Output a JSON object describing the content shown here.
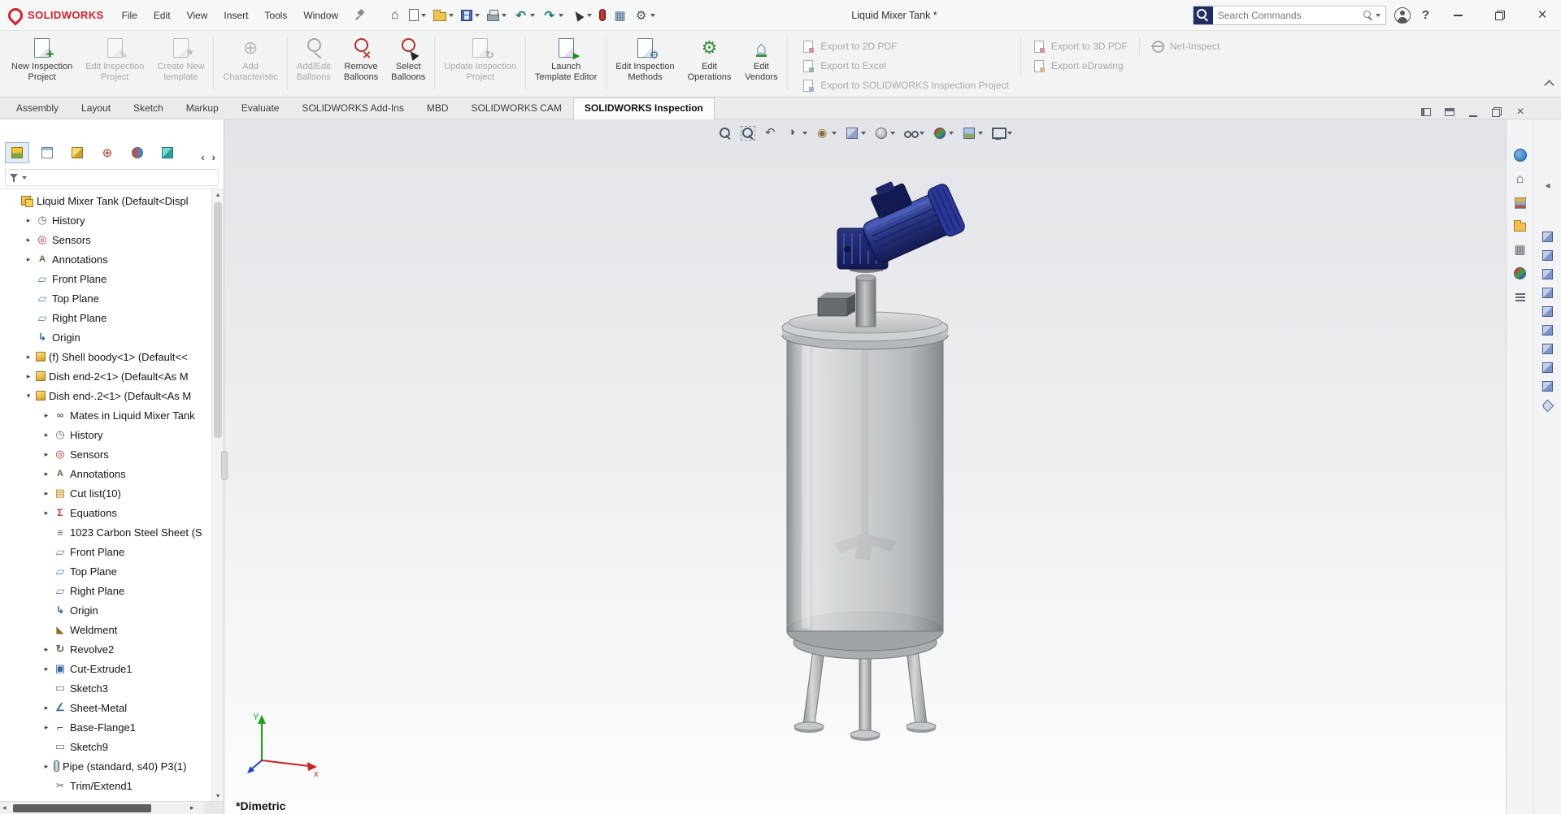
{
  "window": {
    "title": "Liquid Mixer Tank *",
    "brand": "SOLIDWORKS",
    "search_placeholder": "Search Commands"
  },
  "colors": {
    "brand_red": "#d2232a",
    "motor_blue": "#27338f",
    "accent_blue": "#2a6db5",
    "disabled_gray": "#a9a9a9"
  },
  "menubar": {
    "items": [
      {
        "label": "File"
      },
      {
        "label": "Edit"
      },
      {
        "label": "View"
      },
      {
        "label": "Insert"
      },
      {
        "label": "Tools"
      },
      {
        "label": "Window"
      }
    ]
  },
  "quick_toolbar": {
    "items": [
      {
        "name": "home-button",
        "icon": "home-icon",
        "dd": false
      },
      {
        "name": "new-document-button",
        "icon": "new-document-icon",
        "dd": true
      },
      {
        "name": "open-button",
        "icon": "open-icon",
        "dd": true
      },
      {
        "name": "save-button",
        "icon": "save-icon",
        "dd": true
      },
      {
        "name": "print-button",
        "icon": "print-icon",
        "dd": true
      },
      {
        "name": "undo-button",
        "icon": "undo-icon",
        "dd": true
      },
      {
        "name": "redo-button",
        "icon": "redo-icon",
        "dd": true
      },
      {
        "name": "select-button",
        "icon": "select-icon",
        "dd": true
      },
      {
        "name": "xpress-indicator",
        "icon": "xpress-icon",
        "dd": false
      },
      {
        "name": "sheet-button",
        "icon": "sheet-icon",
        "dd": false
      },
      {
        "name": "options-button",
        "icon": "options-icon",
        "dd": true
      }
    ]
  },
  "ribbon": {
    "items": [
      {
        "type": "button",
        "name": "new-inspection-project-button",
        "icon": "new-inspection-project-icon",
        "label": "New Inspection\nProject",
        "state": "enabled",
        "interactable": "true"
      },
      {
        "type": "button",
        "name": "edit-inspection-project-button",
        "icon": "edit-inspection-project-icon",
        "label": "Edit Inspection\nProject",
        "state": "disabled",
        "interactable": "true"
      },
      {
        "type": "button",
        "name": "create-new-template-button",
        "icon": "create-new-template-icon",
        "label": "Create New\ntemplate",
        "state": "disabled",
        "interactable": "true"
      },
      {
        "type": "sep",
        "name": "ribbon-separator",
        "interactable": "false"
      },
      {
        "type": "button",
        "name": "add-characteristic-button",
        "icon": "add-characteristic-icon",
        "label": "Add\nCharacteristic",
        "state": "disabled",
        "interactable": "true"
      },
      {
        "type": "sep",
        "name": "ribbon-separator",
        "interactable": "false"
      },
      {
        "type": "button",
        "name": "add-edit-balloons-button",
        "icon": "add-edit-balloons-icon",
        "label": "Add/Edit\nBalloons",
        "state": "disabled",
        "interactable": "true"
      },
      {
        "type": "button",
        "name": "remove-balloons-button",
        "icon": "remove-balloons-icon",
        "label": "Remove\nBalloons",
        "state": "enabled",
        "interactable": "true"
      },
      {
        "type": "button",
        "name": "select-balloons-button",
        "icon": "select-balloons-icon",
        "label": "Select\nBalloons",
        "state": "enabled",
        "interactable": "true"
      },
      {
        "type": "sep",
        "name": "ribbon-separator",
        "interactable": "false"
      },
      {
        "type": "button",
        "name": "update-inspection-project-button",
        "icon": "update-inspection-project-icon",
        "label": "Update Inspection\nProject",
        "state": "disabled",
        "interactable": "true"
      },
      {
        "type": "sep",
        "name": "ribbon-separator",
        "interactable": "false"
      },
      {
        "type": "button",
        "name": "launch-template-editor-button",
        "icon": "launch-template-editor-icon",
        "label": "Launch\nTemplate Editor",
        "state": "enabled",
        "interactable": "true"
      },
      {
        "type": "sep",
        "name": "ribbon-separator",
        "interactable": "false"
      },
      {
        "type": "button",
        "name": "edit-inspection-methods-button",
        "icon": "edit-inspection-methods-icon",
        "label": "Edit Inspection\nMethods",
        "state": "enabled",
        "interactable": "true"
      },
      {
        "type": "button",
        "name": "edit-operations-button",
        "icon": "edit-operations-icon",
        "label": "Edit\nOperations",
        "state": "enabled",
        "interactable": "true"
      },
      {
        "type": "button",
        "name": "edit-vendors-button",
        "icon": "edit-vendors-icon",
        "label": "Edit\nVendors",
        "state": "enabled",
        "interactable": "true"
      },
      {
        "type": "sep",
        "name": "ribbon-separator",
        "interactable": "false"
      }
    ],
    "export_col1": [
      {
        "name": "export-2d-pdf-button",
        "icon": "export-2d-pdf-icon",
        "label": "Export to 2D PDF"
      },
      {
        "name": "export-excel-button",
        "icon": "export-excel-icon",
        "label": "Export to Excel"
      },
      {
        "name": "export-sw-inspection-button",
        "icon": "export-sw-inspection-icon",
        "label": "Export to SOLIDWORKS Inspection Project"
      }
    ],
    "export_col2": [
      {
        "name": "export-3d-pdf-button",
        "icon": "export-3d-pdf-icon",
        "label": "Export to 3D PDF"
      },
      {
        "name": "export-edrawing-button",
        "icon": "export-edrawing-icon",
        "label": "Export eDrawing"
      }
    ],
    "export_col3": [
      {
        "name": "net-inspect-button",
        "icon": "net-inspect-icon",
        "label": "Net-Inspect"
      }
    ]
  },
  "command_tabs": {
    "items": [
      {
        "label": "Assembly"
      },
      {
        "label": "Layout"
      },
      {
        "label": "Sketch"
      },
      {
        "label": "Markup"
      },
      {
        "label": "Evaluate"
      },
      {
        "label": "SOLIDWORKS Add-Ins"
      },
      {
        "label": "MBD"
      },
      {
        "label": "SOLIDWORKS CAM"
      },
      {
        "label": "SOLIDWORKS Inspection",
        "state": "active"
      }
    ],
    "controls": [
      {
        "name": "dock-pane-button",
        "icon": "dock-pane-icon"
      },
      {
        "name": "float-pane-button",
        "icon": "float-pane-icon"
      },
      {
        "name": "document-minimize-button",
        "icon": "minimize-icon"
      },
      {
        "name": "document-restore-button",
        "icon": "restore-icon"
      },
      {
        "name": "document-close-button",
        "icon": "close-icon"
      }
    ]
  },
  "panel": {
    "tabs": [
      {
        "name": "featuremanager-tab",
        "icon": "featuremanager-icon",
        "state": "active"
      },
      {
        "name": "propertymanager-tab",
        "icon": "propertymanager-icon"
      },
      {
        "name": "configurationmanager-tab",
        "icon": "configurationmanager-icon"
      },
      {
        "name": "dimxpertmanager-tab",
        "icon": "dimxpertmanager-icon"
      },
      {
        "name": "displaymanager-tab",
        "icon": "displaymanager-icon"
      },
      {
        "name": "inspection-manager-tab",
        "icon": "inspection-manager-icon"
      }
    ]
  },
  "feature_tree": {
    "items": [
      {
        "level": 0,
        "arrow": "none",
        "icon": "assembly-icon",
        "label": "Liquid Mixer Tank  (Default<Displ"
      },
      {
        "level": 1,
        "arrow": "right",
        "icon": "history-icon",
        "label": "History"
      },
      {
        "level": 1,
        "arrow": "right",
        "icon": "sensors-icon",
        "label": "Sensors"
      },
      {
        "level": 1,
        "arrow": "right",
        "icon": "annotations-icon",
        "label": "Annotations"
      },
      {
        "level": 1,
        "arrow": "none",
        "icon": "plane-icon",
        "label": "Front Plane"
      },
      {
        "level": 1,
        "arrow": "none",
        "icon": "plane-icon",
        "label": "Top Plane"
      },
      {
        "level": 1,
        "arrow": "none",
        "icon": "plane-icon",
        "label": "Right Plane"
      },
      {
        "level": 1,
        "arrow": "none",
        "icon": "origin-icon",
        "label": "Origin"
      },
      {
        "level": 1,
        "arrow": "right",
        "icon": "part-icon",
        "label": "(f) Shell boody<1>  (Default<<"
      },
      {
        "level": 1,
        "arrow": "right",
        "icon": "part-icon",
        "label": "Dish end-2<1>  (Default<As M"
      },
      {
        "level": 1,
        "arrow": "down",
        "icon": "part-icon",
        "label": "Dish end-.2<1>  (Default<As M"
      },
      {
        "level": 2,
        "arrow": "right",
        "icon": "mates-icon",
        "label": "Mates in Liquid Mixer Tank"
      },
      {
        "level": 2,
        "arrow": "right",
        "icon": "history-icon",
        "label": "History"
      },
      {
        "level": 2,
        "arrow": "right",
        "icon": "sensors-icon",
        "label": "Sensors"
      },
      {
        "level": 2,
        "arrow": "right",
        "icon": "annotations-icon",
        "label": "Annotations"
      },
      {
        "level": 2,
        "arrow": "right",
        "icon": "cutlist-icon",
        "label": "Cut list(10)"
      },
      {
        "level": 2,
        "arrow": "right",
        "icon": "equations-icon",
        "label": "Equations"
      },
      {
        "level": 2,
        "arrow": "none",
        "icon": "material-icon",
        "label": "1023 Carbon Steel Sheet (S"
      },
      {
        "level": 2,
        "arrow": "none",
        "icon": "plane-icon",
        "label": "Front Plane"
      },
      {
        "level": 2,
        "arrow": "none",
        "icon": "plane-icon",
        "label": "Top Plane"
      },
      {
        "level": 2,
        "arrow": "none",
        "icon": "plane-icon",
        "label": "Right Plane"
      },
      {
        "level": 2,
        "arrow": "none",
        "icon": "origin-icon",
        "label": "Origin"
      },
      {
        "level": 2,
        "arrow": "none",
        "icon": "weldment-icon",
        "label": "Weldment"
      },
      {
        "level": 2,
        "arrow": "right",
        "icon": "revolve-icon",
        "label": "Revolve2"
      },
      {
        "level": 2,
        "arrow": "right",
        "icon": "extrude-icon",
        "label": "Cut-Extrude1"
      },
      {
        "level": 2,
        "arrow": "none",
        "icon": "sketch-icon",
        "label": "Sketch3"
      },
      {
        "level": 2,
        "arrow": "right",
        "icon": "sheetmetal-icon",
        "label": "Sheet-Metal"
      },
      {
        "level": 2,
        "arrow": "right",
        "icon": "flange-icon",
        "label": "Base-Flange1"
      },
      {
        "level": 2,
        "arrow": "none",
        "icon": "sketch-icon",
        "label": "Sketch9"
      },
      {
        "level": 2,
        "arrow": "right",
        "icon": "pipe-icon",
        "label": "Pipe (standard, s40) P3(1)"
      },
      {
        "level": 2,
        "arrow": "none",
        "icon": "trim-icon",
        "label": "Trim/Extend1"
      }
    ]
  },
  "viewport": {
    "view_label": "*Dimetric",
    "hud": [
      {
        "name": "zoom-fit-button",
        "icon": "zoom-fit-icon",
        "dd": false
      },
      {
        "name": "zoom-area-button",
        "icon": "zoom-area-icon",
        "dd": false
      },
      {
        "name": "previous-view-button",
        "icon": "previous-view-icon",
        "dd": false
      },
      {
        "name": "section-view-button",
        "icon": "section-view-icon",
        "dd": true
      },
      {
        "name": "annotation-views-button",
        "icon": "annotation-views-icon",
        "dd": true
      },
      {
        "name": "view-orientation-button",
        "icon": "view-orientation-icon",
        "dd": true
      },
      {
        "name": "display-style-button",
        "icon": "display-style-icon",
        "dd": true
      },
      {
        "name": "hide-show-items-button",
        "icon": "hide-show-icon",
        "dd": true
      },
      {
        "name": "edit-appearance-button",
        "icon": "appearance-icon",
        "dd": true
      },
      {
        "name": "apply-scene-button",
        "icon": "scene-icon",
        "dd": true
      },
      {
        "name": "view-settings-button",
        "icon": "view-settings-icon",
        "dd": true
      }
    ]
  },
  "taskpane": {
    "tabs": [
      {
        "name": "3dexperience-tab",
        "icon": "3dexperience-icon"
      },
      {
        "name": "solidworks-resources-tab",
        "icon": "resources-home-icon"
      },
      {
        "name": "design-library-tab",
        "icon": "design-library-icon"
      },
      {
        "name": "file-explorer-tab",
        "icon": "file-explorer-icon"
      },
      {
        "name": "view-palette-tab",
        "icon": "view-palette-icon"
      },
      {
        "name": "appearances-scenes-tab",
        "icon": "appearances-icon"
      },
      {
        "name": "custom-properties-tab",
        "icon": "custom-properties-icon"
      }
    ],
    "cubes": [
      {
        "name": "inspection-cube",
        "icon": "cube-icon"
      },
      {
        "name": "inspection-cube",
        "icon": "cube-icon"
      },
      {
        "name": "inspection-cube",
        "icon": "cube-icon"
      },
      {
        "name": "inspection-cube",
        "icon": "cube-icon"
      },
      {
        "name": "inspection-cube",
        "icon": "cube-icon"
      },
      {
        "name": "inspection-cube",
        "icon": "cube-icon"
      },
      {
        "name": "inspection-cube",
        "icon": "cube-icon"
      },
      {
        "name": "inspection-cube",
        "icon": "cube-icon"
      },
      {
        "name": "inspection-cube",
        "icon": "cube-icon"
      }
    ]
  }
}
